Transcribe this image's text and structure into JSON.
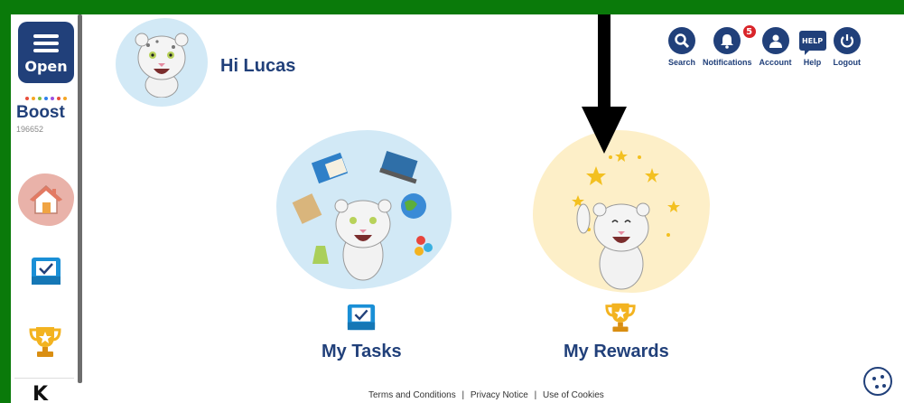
{
  "sidebar": {
    "open_label": "Open",
    "logo_text": "Boost",
    "logo_id": "196652",
    "logo_dot_colors": [
      "#e94e3c",
      "#f5a623",
      "#7bc043",
      "#2f80ed",
      "#9b51e0",
      "#e94e3c",
      "#f5a623"
    ],
    "bottom_logo": "K"
  },
  "header": {
    "greeting": "Hi Lucas"
  },
  "nav": {
    "search": "Search",
    "notifications": "Notifications",
    "notification_count": "5",
    "account": "Account",
    "help": "Help",
    "help_icon_text": "HELP",
    "logout": "Logout"
  },
  "cards": {
    "tasks_label": "My Tasks",
    "rewards_label": "My Rewards"
  },
  "footer": {
    "terms": "Terms and Conditions",
    "privacy": "Privacy Notice",
    "cookies": "Use of Cookies",
    "separator": "|"
  },
  "colors": {
    "brand": "#21407a",
    "badge": "#d9252a",
    "background_frame": "#0a7a0a"
  }
}
